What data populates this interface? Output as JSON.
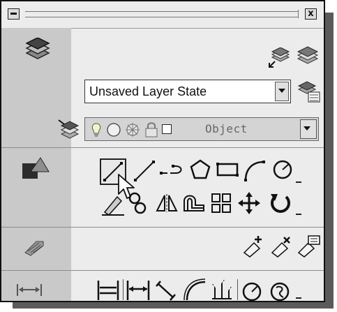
{
  "titlebar": {
    "close_label": "x"
  },
  "layers": {
    "layer_state": {
      "value": "Unsaved Layer State"
    },
    "current_layer": {
      "value": "Object"
    },
    "icons": [
      "layers-icon",
      "make-object-layer-current-icon",
      "layer-previous-icon",
      "layer-states-manager-icon",
      "layer-match-icon",
      "layer-on-off-icon",
      "layer-freeze-icon",
      "layer-freeze-viewport-icon",
      "layer-lock-icon",
      "layer-color-icon"
    ]
  },
  "draw": {
    "icons": [
      "draw-icon",
      "line-icon",
      "construction-line-icon",
      "polyline-icon",
      "polygon-icon",
      "rectangle-icon",
      "arc-icon",
      "circle-icon"
    ]
  },
  "modify": {
    "icons": [
      "erase-icon",
      "copy-icon",
      "mirror-icon",
      "offset-icon",
      "array-icon",
      "move-icon",
      "rotate-icon"
    ]
  },
  "inquiry": {
    "icons": [
      "inquiry-icon",
      "add-selected-icon",
      "select-similar-icon",
      "list-icon"
    ]
  },
  "dimensions": {
    "icons": [
      "dimension-icon",
      "linear-dimension-icon",
      "baseline-dimension-icon",
      "aligned-dimension-icon",
      "arc-length-dimension-icon",
      "ordinate-dimension-icon",
      "radius-dimension-icon",
      "diameter-dimension-icon"
    ]
  }
}
